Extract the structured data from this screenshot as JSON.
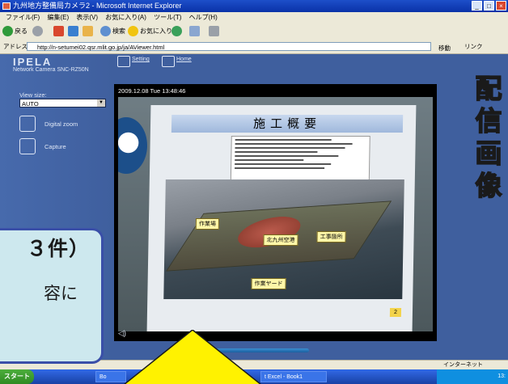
{
  "window": {
    "title": "九州地方整備局カメラ2 - Microsoft Internet Explorer",
    "buttons": [
      "_",
      "□",
      "×"
    ]
  },
  "menu": [
    "ファイル(F)",
    "編集(E)",
    "表示(V)",
    "お気に入り(A)",
    "ツール(T)",
    "ヘルプ(H)"
  ],
  "toolbar": {
    "back": "戻る",
    "search": "検索",
    "favorites": "お気に入り"
  },
  "address": {
    "label": "アドレス(D)",
    "url": "http://n-setumei02.qsr.mlit.go.jp/ja/AViewer.html",
    "go": "移動",
    "links": "リンク"
  },
  "camera_page": {
    "brand": "IPELA",
    "model": "Network Camera SNC-RZ50N",
    "nav": [
      {
        "label": "Setting",
        "icon": "setting-icon"
      },
      {
        "label": "Home",
        "icon": "home-icon"
      }
    ],
    "view_size_label": "View size:",
    "view_size_value": "AUTO",
    "side_buttons": [
      {
        "label": "Digital zoom",
        "icon": "zoom-icon"
      },
      {
        "label": "Capture",
        "icon": "capture-icon"
      }
    ],
    "video_timestamp": "2009.12.08 Tue 13:48:46",
    "board_title": "施工概要",
    "board_callouts": [
      "作業場",
      "北九州空港",
      "工事箇所",
      "作業ヤード"
    ],
    "board_page": "2"
  },
  "statusbar": {
    "zone": "インターネット"
  },
  "taskbar": {
    "start": "スタート",
    "tasks": [
      "Bo",
      "t Excel - Book1"
    ],
    "clock": "13:"
  },
  "overlay": {
    "vertical_title": [
      "配",
      "信",
      "画",
      "像"
    ],
    "bubble_line1": "３件）",
    "bubble_line2": "容に"
  },
  "colors": {
    "vertical_title": "#e8222a",
    "bubble_border": "#3a4fa8",
    "bubble_fill": "#cde8ee",
    "arrow": "#fff200",
    "camera_bg": "#3f5f9e"
  }
}
